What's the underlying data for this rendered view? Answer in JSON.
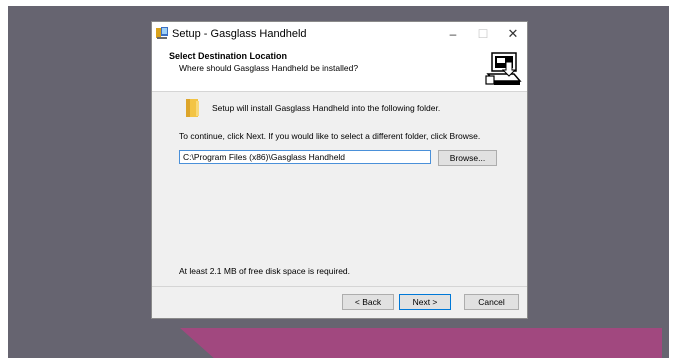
{
  "window": {
    "title": "Setup - Gasglass Handheld",
    "controls": {
      "minimize": "–",
      "maximize": "☐",
      "close": "✕"
    }
  },
  "header": {
    "title": "Select Destination Location",
    "subtitle": "Where should Gasglass Handheld be installed?"
  },
  "main": {
    "intro": "Setup will install Gasglass Handheld into the following folder.",
    "instruction": "To continue, click Next. If you would like to select a different folder, click Browse.",
    "path_value": "C:\\Program Files (x86)\\Gasglass Handheld",
    "browse_label": "Browse...",
    "disk_space": "At least 2.1 MB of free disk space is required."
  },
  "footer": {
    "back_label": "< Back",
    "next_label": "Next >",
    "cancel_label": "Cancel"
  },
  "colors": {
    "backdrop": "#666470",
    "banner": "#a1487f",
    "focus_accent": "#0078d7"
  },
  "icons": {
    "app": "setup-app-icon",
    "wizard": "computer-install-icon",
    "folder": "folder-icon"
  }
}
